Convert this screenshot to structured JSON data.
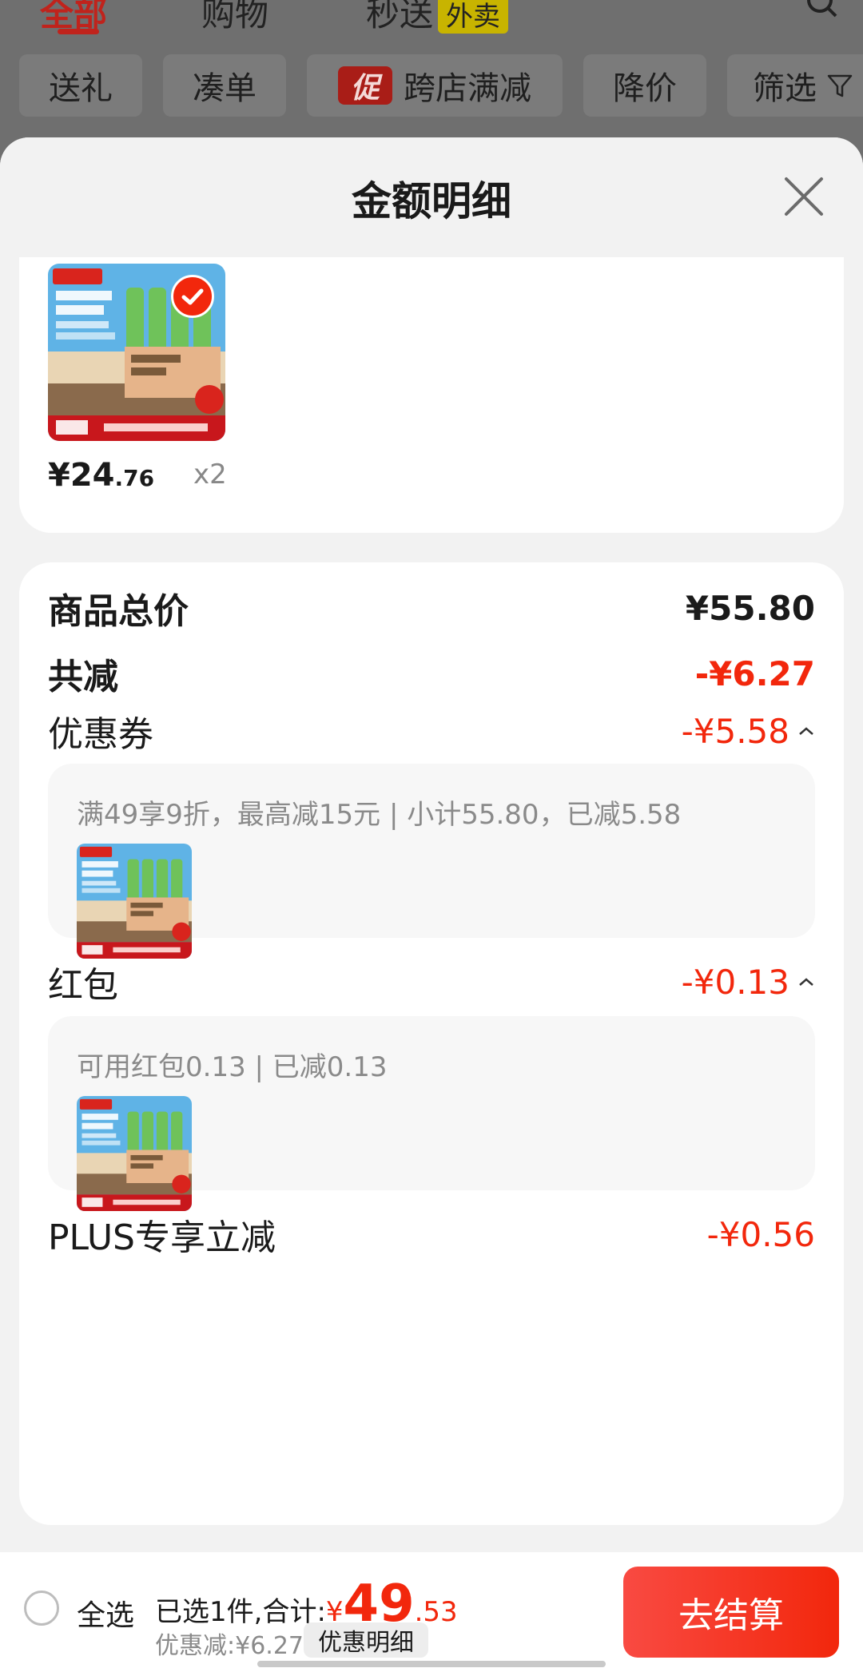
{
  "top_tabs": [
    {
      "label": "全部"
    },
    {
      "label": "购物"
    },
    {
      "label": "秒送",
      "badge": "外卖"
    }
  ],
  "filters": [
    {
      "label": "送礼"
    },
    {
      "label": "凑单"
    },
    {
      "label": "跨店满减",
      "badge": "促"
    },
    {
      "label": "降价"
    },
    {
      "label": "筛选"
    }
  ],
  "sheet": {
    "title": "金额明细"
  },
  "product": {
    "price_int": "¥24",
    "price_dec": ".76",
    "qty": "x2"
  },
  "summary": {
    "total_label": "商品总价",
    "total_value": "¥55.80",
    "discount_label": "共减",
    "discount_value": "-¥6.27",
    "coupon_label": "优惠券",
    "coupon_value": "-¥5.58",
    "coupon_detail": "满49享9折，最高减15元 | 小计55.80，已减5.58",
    "redpacket_label": "红包",
    "redpacket_value": "-¥0.13",
    "redpacket_detail": "可用红包0.13 | 已减0.13",
    "plus_label": "PLUS专享立减",
    "plus_value": "-¥0.56"
  },
  "bottom": {
    "select_all": "全选",
    "selected_prefix": "已选1件,合计:",
    "total_yen": "¥",
    "total_int": "49",
    "total_dec": ".53",
    "discount_text": "优惠减:¥6.27",
    "detail_button": "优惠明细",
    "checkout_button": "去结算"
  },
  "colors": {
    "accent_red": "#f2270c",
    "overlay_gray": "#6f6f6f"
  }
}
